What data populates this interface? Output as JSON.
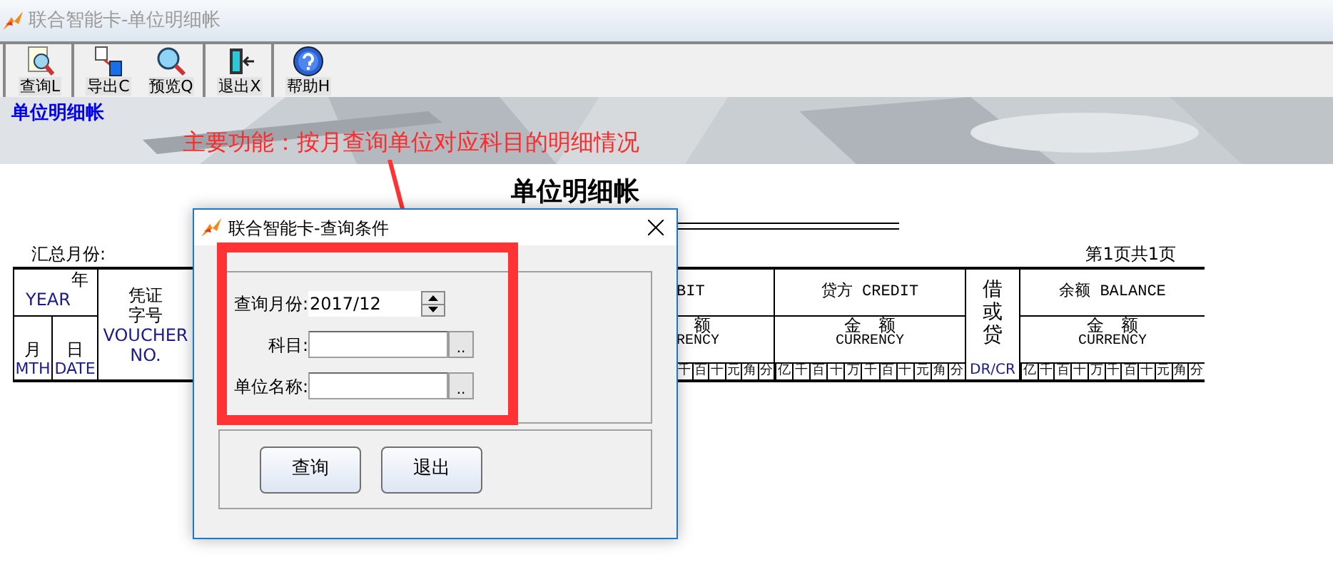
{
  "window": {
    "title": "联合智能卡-单位明细帐"
  },
  "toolbar": [
    [
      {
        "label": "查询L"
      }
    ],
    [
      {
        "label": "导出C"
      },
      {
        "label": "预览Q"
      }
    ],
    [
      {
        "label": "退出X"
      }
    ],
    [
      {
        "label": "帮助H"
      }
    ]
  ],
  "banner": {
    "title": "单位明细帐",
    "note": "主要功能：按月查询单位对应科目的明细情况"
  },
  "report": {
    "title": "单位明细帐",
    "month_label": "汇总月份:",
    "page_info": "第1页共1页",
    "year": {
      "top": "年",
      "top_en": "YEAR",
      "month": "月",
      "month_en": "MTH",
      "day": "日",
      "day_en": "DATE"
    },
    "voucher": {
      "label": [
        "凭证",
        "字号"
      ],
      "label_en": [
        "VOUCHER",
        "NO."
      ]
    },
    "debit": {
      "heading": "BIT",
      "sub": "额",
      "sub_en": "RENCY",
      "digits": [
        "千",
        "百",
        "十",
        "元",
        "角",
        "分"
      ]
    },
    "credit": {
      "heading": "贷方 CREDIT",
      "sub": "金　额",
      "sub_en": "CURRENCY",
      "digits": [
        "亿",
        "千",
        "百",
        "十",
        "万",
        "千",
        "百",
        "十",
        "元",
        "角",
        "分"
      ]
    },
    "drcr": {
      "label": [
        "借",
        "或",
        "贷"
      ],
      "label_en": "DR/CR"
    },
    "balance": {
      "heading": "余额 BALANCE",
      "sub": "金　额",
      "sub_en": "CURRENCY",
      "digits": [
        "亿",
        "千",
        "百",
        "十",
        "万",
        "千",
        "百",
        "十",
        "元",
        "角",
        "分"
      ]
    }
  },
  "dialog": {
    "title": "联合智能卡-查询条件",
    "month_label": "查询月份:",
    "month_value": "2017/12",
    "subject_label": "科目:",
    "unit_label": "单位名称:",
    "browse": "..",
    "browse2": "..",
    "buttons": [
      "查询",
      "退出"
    ]
  }
}
